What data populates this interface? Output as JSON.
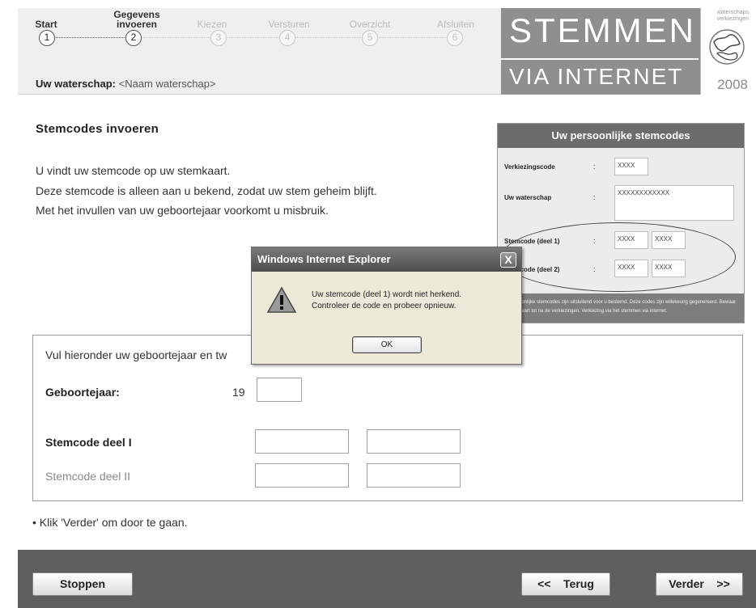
{
  "steps": [
    {
      "label": "Start",
      "num": "1",
      "state": "done"
    },
    {
      "label": "Gegevens invoeren",
      "num": "2",
      "state": "done"
    },
    {
      "label": "Kiezen",
      "num": "3",
      "state": "todo"
    },
    {
      "label": "Versturen",
      "num": "4",
      "state": "todo"
    },
    {
      "label": "Overzicht",
      "num": "5",
      "state": "todo"
    },
    {
      "label": "Afsluiten",
      "num": "6",
      "state": "todo"
    }
  ],
  "waterschap": {
    "label": "Uw waterschap:",
    "value": "<Naam waterschap>"
  },
  "logo": {
    "line1": "STEMMEN",
    "line2": "VIA INTERNET",
    "side_caption": "waterschaps verkiezingen",
    "year": "2008"
  },
  "content": {
    "title": "Stemcodes invoeren",
    "intro": [
      "U vindt uw stemcode op uw stemkaart.",
      "Deze stemcode is alleen aan u bekend, zodat uw stem geheim blijft.",
      "Met het invullen van uw geboortejaar voorkomt u misbruik."
    ]
  },
  "card": {
    "title": "Uw persoonlijke stemcodes",
    "rows": [
      {
        "label": "Verkiezingscode",
        "values": [
          "XXXX"
        ]
      },
      {
        "label": "Uw waterschap",
        "values": [
          "XXXXXXXXXXXX"
        ]
      },
      {
        "label": "Stemcode (deel 1)",
        "values": [
          "XXXX",
          "XXXX"
        ]
      },
      {
        "label": "Stemcode (deel 2)",
        "values": [
          "XXXX",
          "XXXX"
        ]
      }
    ],
    "footer": "Uw persoonlijke stemcodes zijn uitsluitend voor u bestemd. Deze codes zijn willekeurig gegenereerd. Bewaar uw stemkaart tot na de verkiezingen. Verkiezing via het stemmen via internet."
  },
  "form": {
    "instruction": "Vul hieronder uw geboortejaar en tw",
    "birth_label": "Geboortejaar:",
    "birth_prefix": "19",
    "code1_label": "Stemcode deel I",
    "code2_label": "Stemcode deel II"
  },
  "hint": "• Klik 'Verder' om door te gaan.",
  "footer": {
    "stop": "Stoppen",
    "back": "Terug",
    "next": "Verder",
    "back_arrow": "<<",
    "next_arrow": ">>"
  },
  "dialog": {
    "title": "Windows Internet Explorer",
    "close": "X",
    "message_line1": "Uw stemcode (deel 1) wordt niet herkend.",
    "message_line2": "Controleer de code en probeer opnieuw.",
    "ok": "OK"
  }
}
